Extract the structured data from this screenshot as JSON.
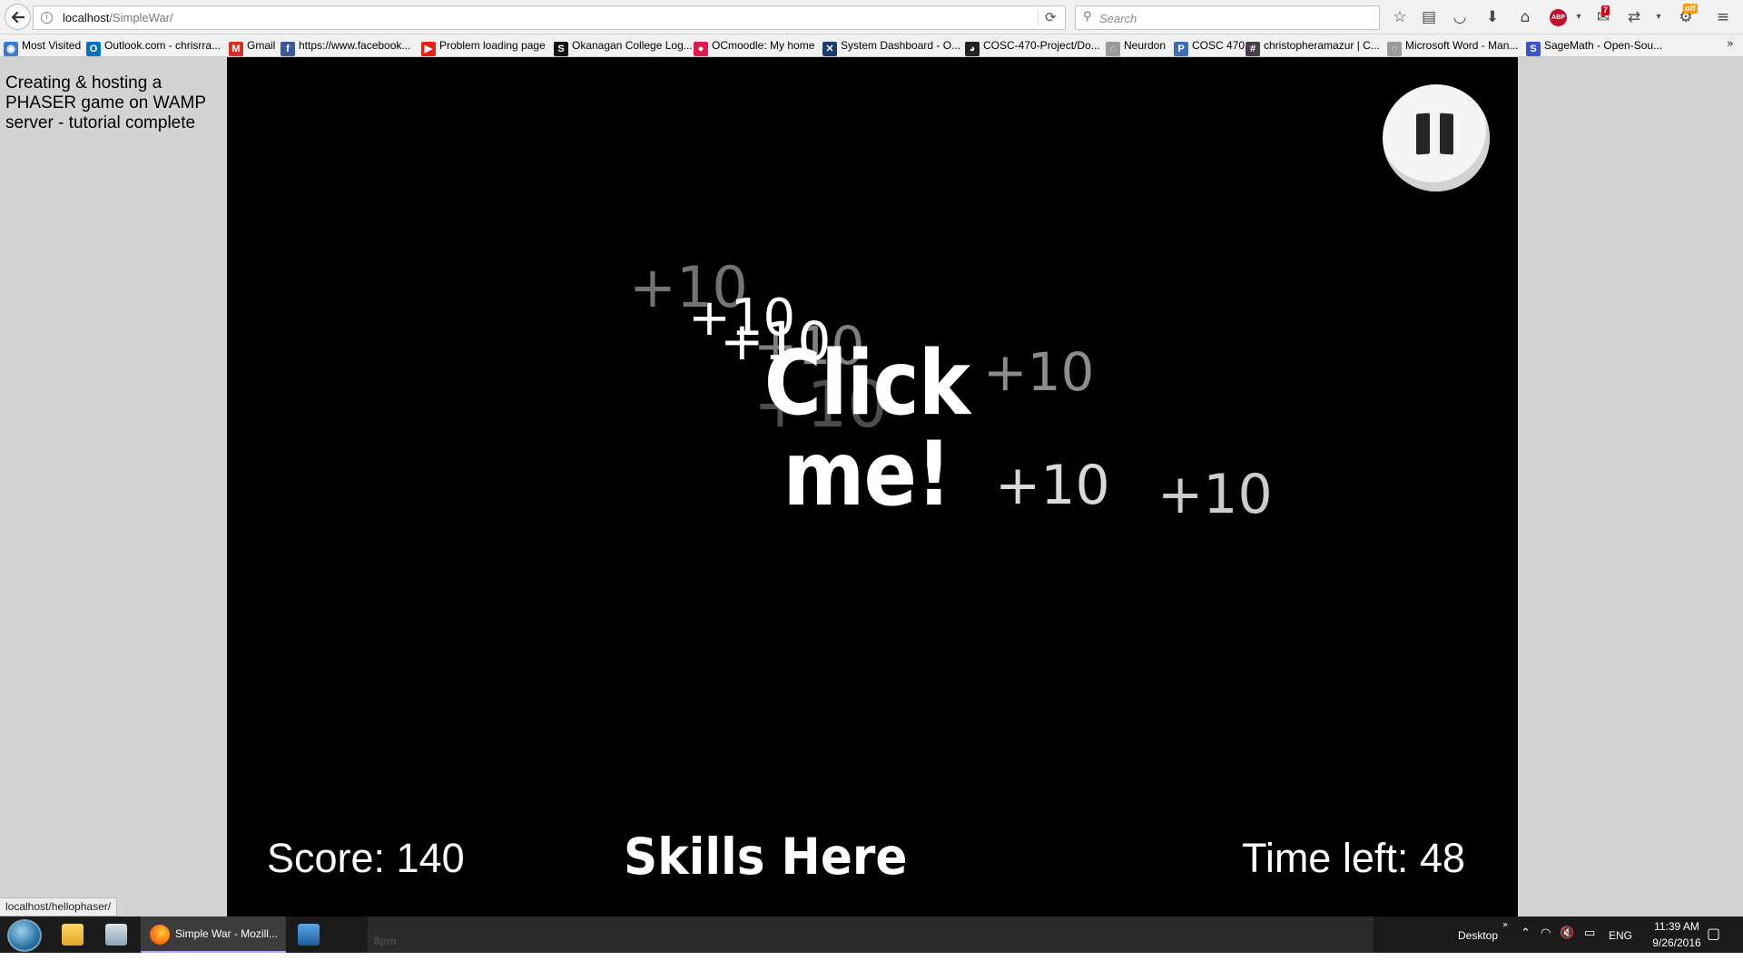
{
  "browser": {
    "url_host": "localhost",
    "url_path": "/SimpleWar/",
    "search_placeholder": "Search",
    "notification_count": "7",
    "addon_badge": "off"
  },
  "bookmarks": [
    {
      "label": "Most Visited",
      "icon": "most-visited-icon",
      "color": "#3a7bd5"
    },
    {
      "label": "Outlook.com - chrisrra...",
      "icon": "outlook-icon",
      "color": "#0072c6"
    },
    {
      "label": "Gmail",
      "icon": "gmail-icon",
      "color": "#d93025"
    },
    {
      "label": "https://www.facebook...",
      "icon": "facebook-icon",
      "color": "#3b5998"
    },
    {
      "label": "Problem loading page",
      "icon": "youtube-icon",
      "color": "#e62117"
    },
    {
      "label": "Okanagan College Log...",
      "icon": "okanagan-icon",
      "color": "#111111"
    },
    {
      "label": "OCmoodle: My home",
      "icon": "moodle-icon",
      "color": "#e2184e"
    },
    {
      "label": "System Dashboard - O...",
      "icon": "jira-icon",
      "color": "#1a3d6f"
    },
    {
      "label": "COSC-470-Project/Do...",
      "icon": "github-icon",
      "color": "#222222"
    },
    {
      "label": "Neurdon",
      "icon": "globe-icon",
      "color": "#9a9a9a"
    },
    {
      "label": "COSC 470",
      "icon": "pivotal-icon",
      "color": "#3d6fb2"
    },
    {
      "label": "christopheramazur | C...",
      "icon": "slack-icon",
      "color": "#4a3c4b"
    },
    {
      "label": "Microsoft Word - Man...",
      "icon": "globe-icon",
      "color": "#9a9a9a"
    },
    {
      "label": "SageMath - Open-Sou...",
      "icon": "sagemath-icon",
      "color": "#3b56c4"
    }
  ],
  "sidebar": {
    "text": "Creating & hosting a PHASER game on WAMP server - tutorial complete"
  },
  "game": {
    "click_label": "Click me!",
    "floating_points": [
      {
        "text": "+10",
        "opacity": 0.45
      },
      {
        "text": "+10",
        "opacity": 1.0
      },
      {
        "text": "+10",
        "opacity": 1.0
      },
      {
        "text": "+10",
        "opacity": 0.5
      },
      {
        "text": "+10",
        "opacity": 0.55
      },
      {
        "text": "+10",
        "opacity": 0.85
      },
      {
        "text": "+10",
        "opacity": 0.8
      },
      {
        "text": "+10",
        "opacity": 0.3
      }
    ],
    "score_label": "Score: 140",
    "skills_label": "Skills Here",
    "time_label": "Time left: 48"
  },
  "status_bar": {
    "url": "localhost/hellophaser/"
  },
  "taskbar": {
    "firefox_task": "Simple War - Mozill...",
    "preview_text": "8pm",
    "desktop_label": "Desktop",
    "language": "ENG",
    "time": "11:39 AM",
    "date": "9/26/2016"
  }
}
